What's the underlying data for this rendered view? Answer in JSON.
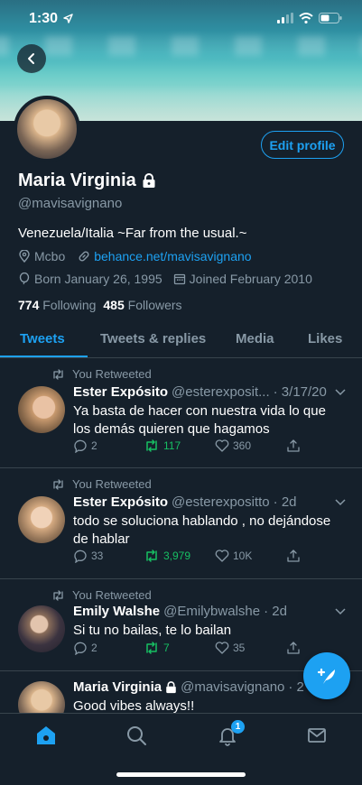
{
  "status": {
    "time": "1:30"
  },
  "profile": {
    "name": "Maria Virginia",
    "handle": "@mavisavignano",
    "bio": "Venezuela/Italia ~Far from the usual.~",
    "location": "Mcbo",
    "website": "behance.net/mavisavignano",
    "born": "Born January 26, 1995",
    "joined": "Joined February 2010",
    "following_count": "774",
    "following_label": "Following",
    "followers_count": "485",
    "followers_label": "Followers",
    "edit_label": "Edit profile"
  },
  "tabs": [
    {
      "label": "Tweets",
      "active": true
    },
    {
      "label": "Tweets & replies"
    },
    {
      "label": "Media"
    },
    {
      "label": "Likes"
    }
  ],
  "tweets": [
    {
      "retweet_label": "You Retweeted",
      "name": "Ester Expósito",
      "handle": "@esterexposit...",
      "time": "· 3/17/20",
      "text": "Ya basta de hacer con nuestra vida lo que los demás quieren que hagamos",
      "replies": "2",
      "retweets": "117",
      "likes": "360"
    },
    {
      "retweet_label": "You Retweeted",
      "name": "Ester Expósito",
      "handle": "@esterexpositto",
      "time": "· 2d",
      "text": "todo se soluciona hablando , no dejándose de hablar",
      "replies": "33",
      "retweets": "3,979",
      "likes": "10K"
    },
    {
      "retweet_label": "You Retweeted",
      "name": "Emily Walshe",
      "handle": "@Emilybwalshe",
      "time": "· 2d",
      "text": "Si tu no bailas, te lo bailan",
      "replies": "2",
      "retweets": "7",
      "likes": "35"
    },
    {
      "name": "Maria Virginia",
      "handle": "@mavisavignano",
      "time": "· 2",
      "text": "Good vibes always!!"
    }
  ],
  "nav": {
    "notifications_badge": "1"
  },
  "colors": {
    "background": "#15202b",
    "accent": "#1da1f2",
    "retweet_green": "#17bf63",
    "muted": "#8899a6"
  }
}
